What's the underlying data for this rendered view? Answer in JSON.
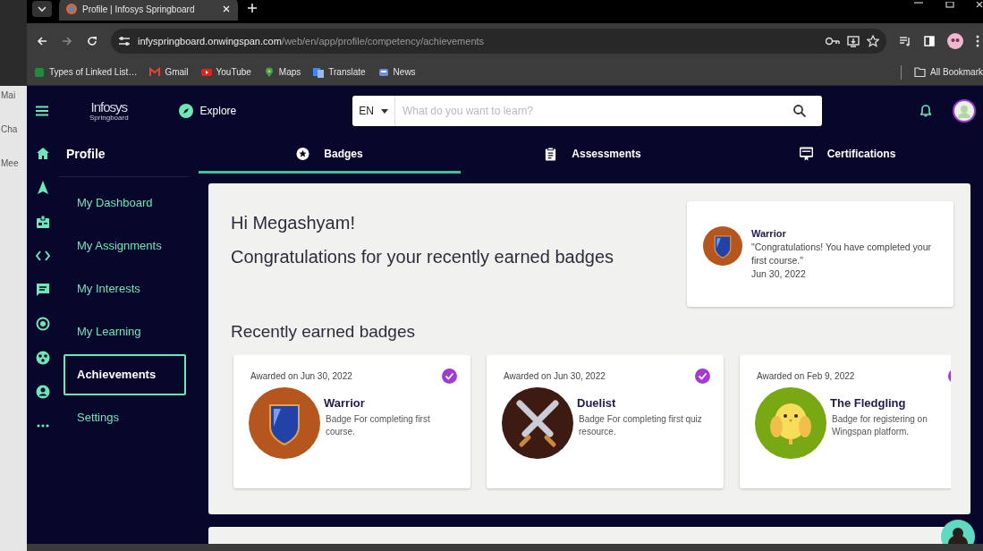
{
  "background_window": {
    "fragments": [
      "Mai",
      "Cha",
      "Mee"
    ]
  },
  "browser": {
    "tab_title": "Profile | Infosys Springboard",
    "url_host": "infyspringboard.onwingspan.com",
    "url_path": "/web/en/app/profile/competency/achievements",
    "bookmarks": [
      {
        "label": "Types of Linked List…",
        "kind": "sheets"
      },
      {
        "label": "Gmail",
        "kind": "gmail"
      },
      {
        "label": "YouTube",
        "kind": "youtube"
      },
      {
        "label": "Maps",
        "kind": "maps"
      },
      {
        "label": "Translate",
        "kind": "translate"
      },
      {
        "label": "News",
        "kind": "news"
      }
    ],
    "all_bookmarks": "All Bookmark"
  },
  "header": {
    "logo_top": "Infosys",
    "logo_bottom": "Springboard",
    "explore": "Explore",
    "language": "EN",
    "search_placeholder": "What do you want to learn?"
  },
  "sidebar": {
    "title": "Profile",
    "items": [
      {
        "label": "My Dashboard",
        "selected": false
      },
      {
        "label": "My Assignments",
        "selected": false
      },
      {
        "label": "My Interests",
        "selected": false
      },
      {
        "label": "My Learning",
        "selected": false
      },
      {
        "label": "Achievements",
        "selected": true
      },
      {
        "label": "Settings",
        "selected": false
      }
    ]
  },
  "tabs": [
    {
      "label": "Badges",
      "kind": "star",
      "selected": true
    },
    {
      "label": "Assessments",
      "kind": "clipboard",
      "selected": false
    },
    {
      "label": "Certifications",
      "kind": "certificate",
      "selected": false
    }
  ],
  "greeting": "Hi Megashyam!",
  "subtitle": "Congratulations for your recently earned badges",
  "latest_badge": {
    "name": "Warrior",
    "message": "\"Congratulations! You have completed your first course.\"",
    "date": "Jun 30, 2022",
    "kind": "shield"
  },
  "section_title": "Recently earned badges",
  "badges": [
    {
      "awarded": "Awarded on Jun 30, 2022",
      "name": "Warrior",
      "description": "Badge For completing first course.",
      "kind": "shield",
      "verified": true
    },
    {
      "awarded": "Awarded on Jun 30, 2022",
      "name": "Duelist",
      "description": "Badge For completing first quiz resource.",
      "kind": "swords",
      "verified": true
    },
    {
      "awarded": "Awarded on Feb 9, 2022",
      "name": "The Fledgling",
      "description": "Badge for registering on Wingspan platform.",
      "kind": "bird",
      "verified": true
    }
  ]
}
